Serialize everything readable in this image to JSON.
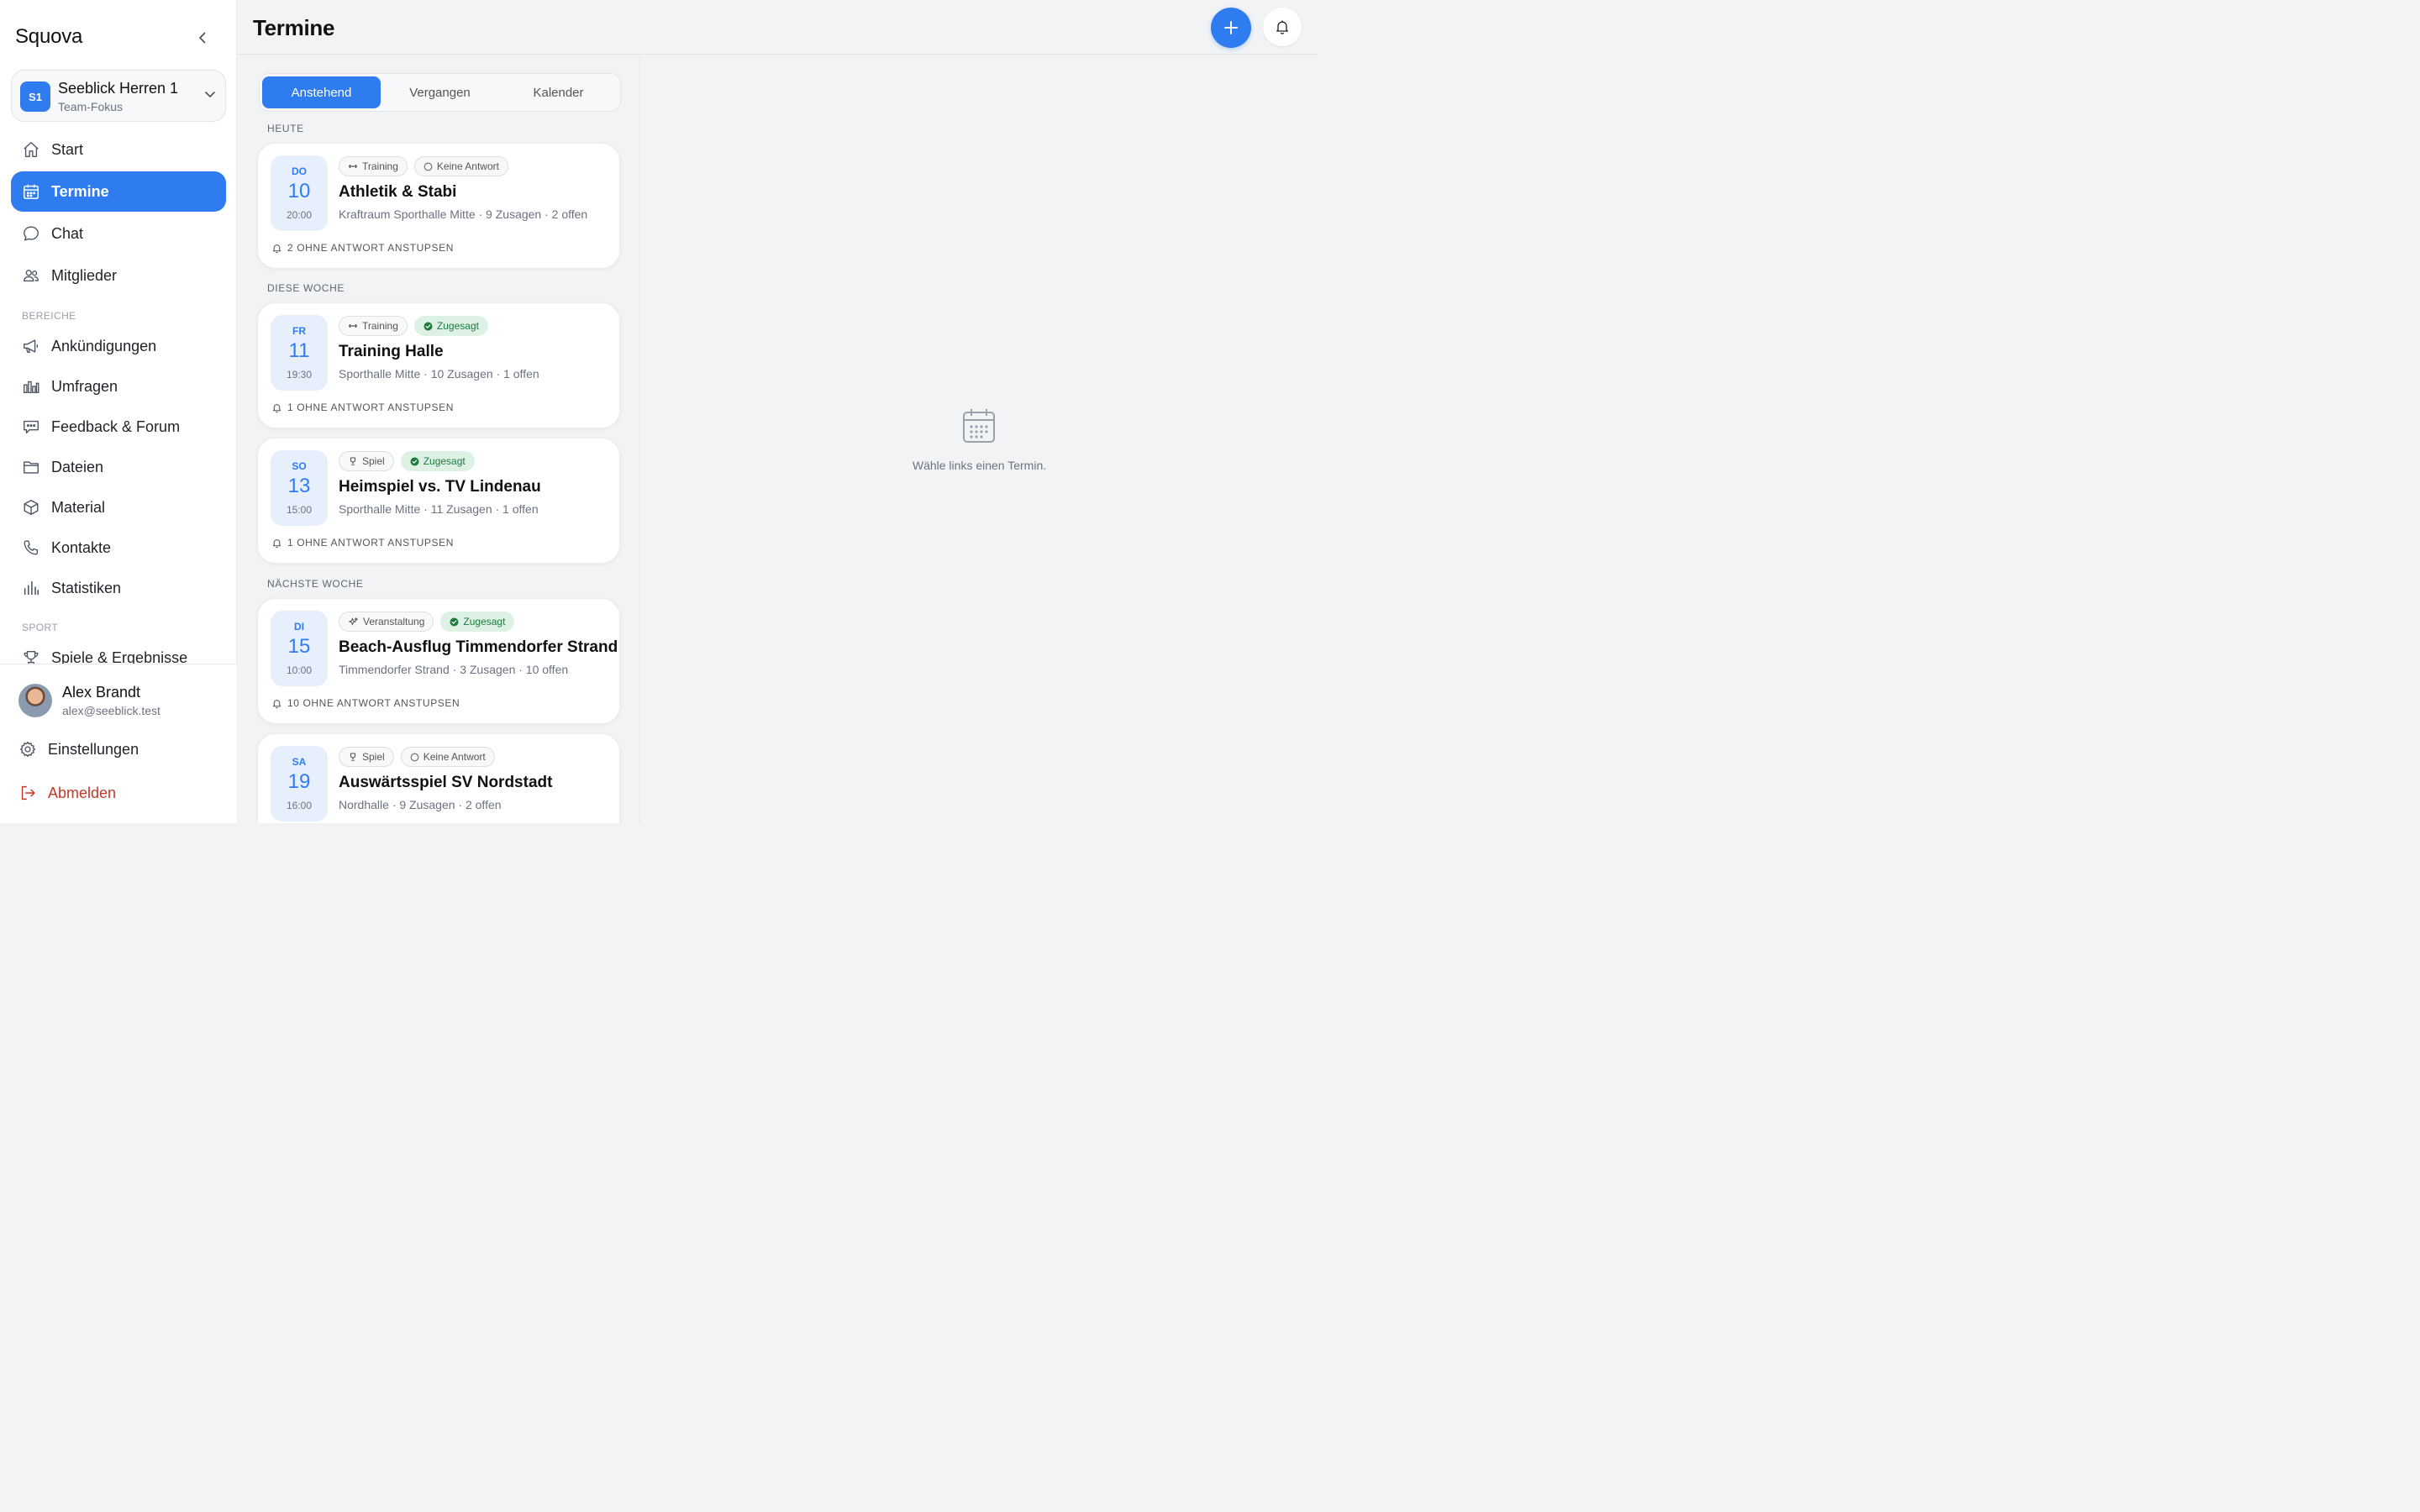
{
  "sidebar": {
    "brand": "Squova",
    "team": {
      "initials": "S1",
      "name": "Seeblick Herren 1",
      "subtitle": "Team-Fokus"
    },
    "nav": [
      {
        "label": "Start",
        "icon": "home-icon"
      },
      {
        "label": "Termine",
        "icon": "calendar-icon",
        "active": true
      },
      {
        "label": "Chat",
        "icon": "chat-icon"
      },
      {
        "label": "Mitglieder",
        "icon": "users-icon"
      }
    ],
    "section_bereiche": "BEREICHE",
    "bereiche": [
      {
        "label": "Ankündigungen",
        "icon": "megaphone-icon"
      },
      {
        "label": "Umfragen",
        "icon": "poll-chart-icon"
      },
      {
        "label": "Feedback & Forum",
        "icon": "forum-icon"
      },
      {
        "label": "Dateien",
        "icon": "folder-icon"
      },
      {
        "label": "Material",
        "icon": "box-icon"
      },
      {
        "label": "Kontakte",
        "icon": "phone-icon"
      },
      {
        "label": "Statistiken",
        "icon": "bar-chart-icon"
      }
    ],
    "section_sport": "SPORT",
    "sport": [
      {
        "label": "Spiele & Ergebnisse",
        "icon": "trophy-icon"
      }
    ],
    "user": {
      "name": "Alex Brandt",
      "email": "alex@seeblick.test"
    },
    "settings_label": "Einstellungen",
    "logout_label": "Abmelden"
  },
  "header": {
    "title": "Termine"
  },
  "tabs": [
    {
      "label": "Anstehend",
      "active": true
    },
    {
      "label": "Vergangen"
    },
    {
      "label": "Kalender"
    }
  ],
  "groups": {
    "today": "HEUTE",
    "this_week": "DIESE WOCHE",
    "next_week": "NÄCHSTE WOCHE"
  },
  "events": [
    {
      "dow": "DO",
      "day": "10",
      "time": "20:00",
      "type": "Training",
      "type_icon": "dumbbell-icon",
      "status": "Keine Antwort",
      "status_kind": "none",
      "title": "Athletik & Stabi",
      "meta": "Kraftraum Sporthalle Mitte · 9 Zusagen · 2 offen",
      "nudge": "2 OHNE ANTWORT ANSTUPSEN"
    },
    {
      "dow": "FR",
      "day": "11",
      "time": "19:30",
      "type": "Training",
      "type_icon": "dumbbell-icon",
      "status": "Zugesagt",
      "status_kind": "yes",
      "title": "Training Halle",
      "meta": "Sporthalle Mitte · 10 Zusagen · 1 offen",
      "nudge": "1 OHNE ANTWORT ANSTUPSEN"
    },
    {
      "dow": "SO",
      "day": "13",
      "time": "15:00",
      "type": "Spiel",
      "type_icon": "trophy-icon",
      "status": "Zugesagt",
      "status_kind": "yes",
      "title": "Heimspiel vs. TV Lindenau",
      "meta": "Sporthalle Mitte · 11 Zusagen · 1 offen",
      "nudge": "1 OHNE ANTWORT ANSTUPSEN"
    },
    {
      "dow": "DI",
      "day": "15",
      "time": "10:00",
      "type": "Veranstaltung",
      "type_icon": "sparkles-icon",
      "status": "Zugesagt",
      "status_kind": "yes",
      "title": "Beach-Ausflug Timmendorfer Strand",
      "meta": "Timmendorfer Strand · 3 Zusagen · 10 offen",
      "nudge": "10 OHNE ANTWORT ANSTUPSEN"
    },
    {
      "dow": "SA",
      "day": "19",
      "time": "16:00",
      "type": "Spiel",
      "type_icon": "trophy-icon",
      "status": "Keine Antwort",
      "status_kind": "none",
      "title": "Auswärtsspiel SV Nordstadt",
      "meta": "Nordhalle · 9 Zusagen · 2 offen"
    }
  ],
  "detail": {
    "empty_text": "Wähle links einen Termin."
  },
  "colors": {
    "accent": "#2f7cf0",
    "success": "#1f7a3e",
    "danger": "#c0392b"
  }
}
